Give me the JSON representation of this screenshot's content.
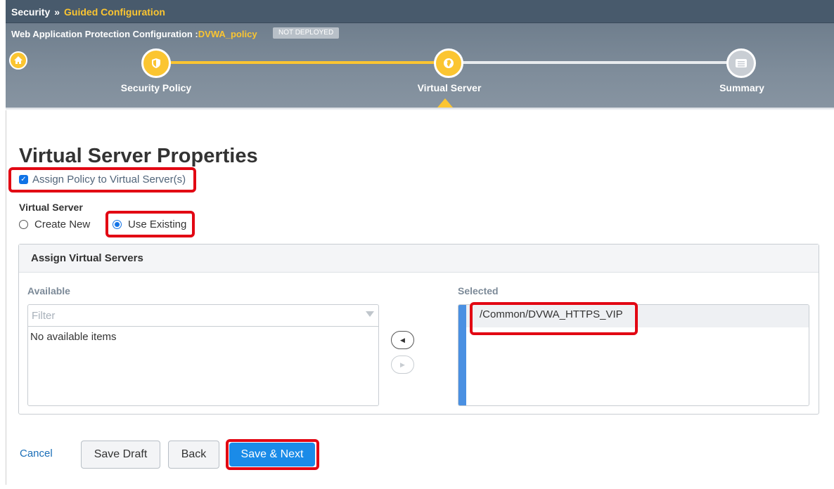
{
  "breadcrumb": {
    "section": "Security",
    "separator": "»",
    "current": "Guided Configuration"
  },
  "banner": {
    "title_prefix": "Web Application Protection Configuration :",
    "policy_name": "DVWA_policy",
    "status_badge": "NOT DEPLOYED"
  },
  "steps": [
    {
      "label": "Security Policy",
      "state": "complete"
    },
    {
      "label": "Virtual Server",
      "state": "active"
    },
    {
      "label": "Summary",
      "state": "pending"
    }
  ],
  "page": {
    "title": "Virtual Server Properties",
    "assign_checkbox_label": "Assign Policy to Virtual Server(s)",
    "assign_checked": true,
    "virtual_server_label": "Virtual Server",
    "radio_create_new": "Create New",
    "radio_use_existing": "Use Existing",
    "selected_radio": "Use Existing"
  },
  "assign_panel": {
    "title": "Assign Virtual Servers",
    "available_label": "Available",
    "filter_placeholder": "Filter",
    "available_empty_text": "No available items",
    "selected_label": "Selected",
    "selected_items": [
      "/Common/DVWA_HTTPS_VIP"
    ]
  },
  "footer": {
    "cancel": "Cancel",
    "save_draft": "Save Draft",
    "back": "Back",
    "save_next": "Save & Next"
  },
  "colors": {
    "accent": "#fbc531",
    "highlight": "#e20613",
    "primary": "#1a8be8"
  }
}
